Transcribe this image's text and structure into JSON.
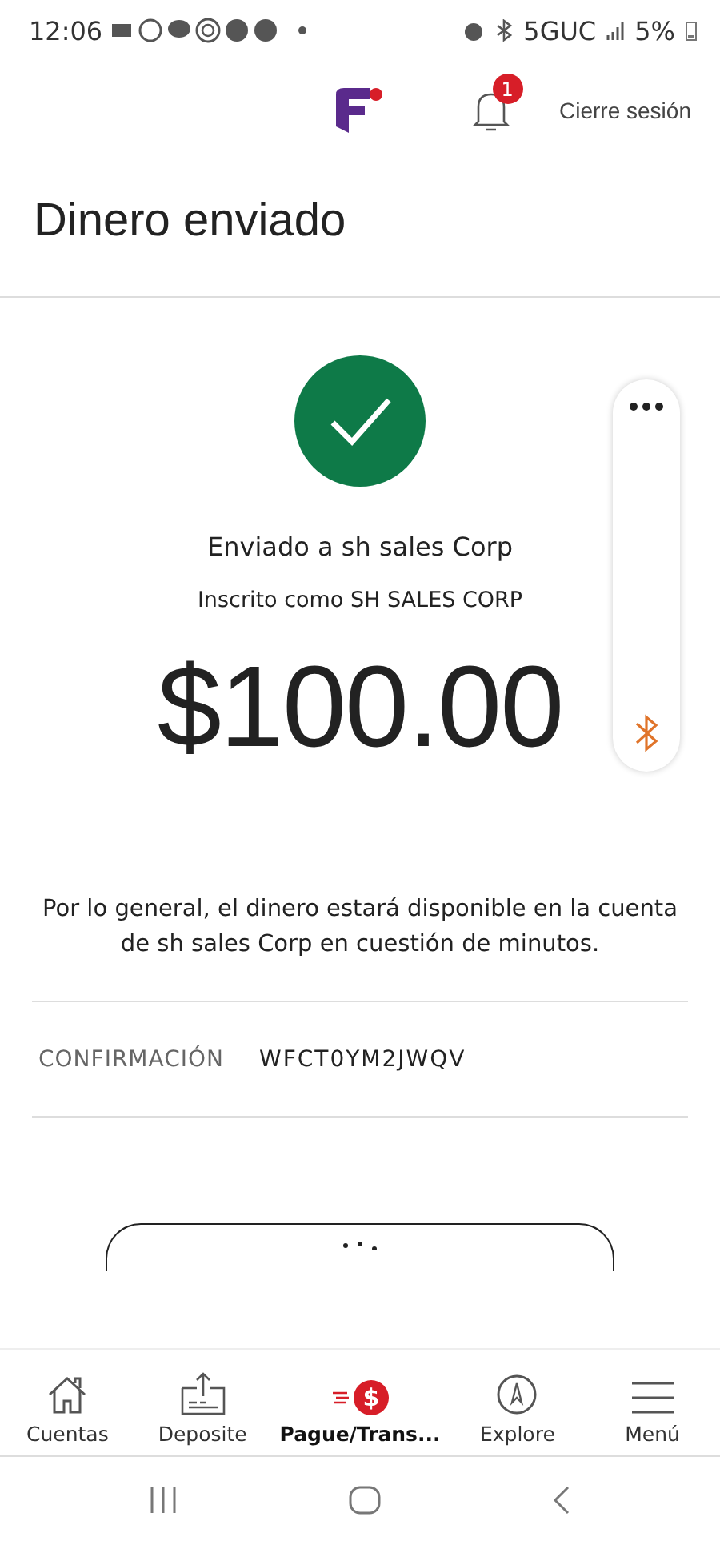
{
  "status_bar": {
    "time": "12:06",
    "network": "5GUC",
    "battery": "5%"
  },
  "header": {
    "notification_count": "1",
    "logout": "Cierre sesión"
  },
  "title": "Dinero enviado",
  "confirmation": {
    "sent_to": "Enviado a sh sales Corp",
    "registered_as": "Inscrito como SH SALES CORP",
    "amount": "$100.00",
    "note": "Por lo general, el dinero estará disponible en la cuenta de sh sales Corp en cuestión de minutos.",
    "label": "CONFIRMACIÓN",
    "code": "WFCT0YM2JWQV"
  },
  "bottom_nav": [
    {
      "kind": "home",
      "label": "Cuentas",
      "selected": false
    },
    {
      "kind": "deposit",
      "label": "Deposite",
      "selected": false
    },
    {
      "kind": "pay",
      "label": "Pague/Trans...",
      "selected": true,
      "glyph": "$"
    },
    {
      "kind": "explore",
      "label": "Explore",
      "selected": false
    },
    {
      "kind": "menu",
      "label": "Menú",
      "selected": false
    }
  ]
}
